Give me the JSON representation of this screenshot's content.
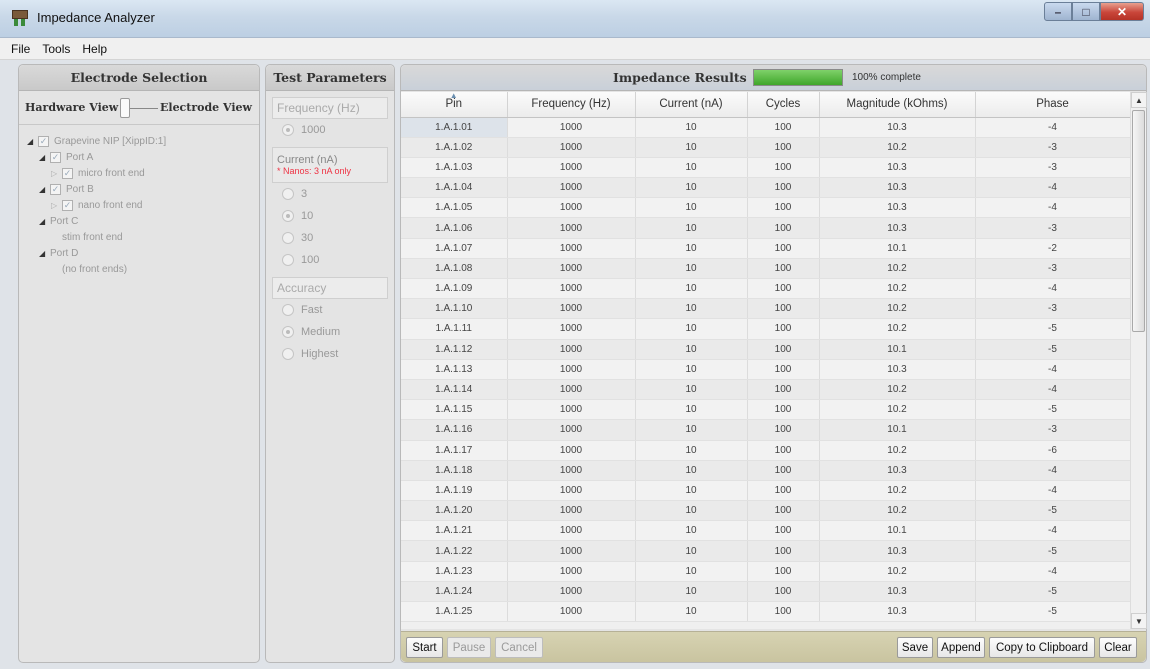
{
  "window": {
    "title": "Impedance Analyzer"
  },
  "menu": [
    "File",
    "Tools",
    "Help"
  ],
  "electrode": {
    "title": "Electrode Selection",
    "toggle_left": "Hardware View",
    "toggle_right": "Electrode View",
    "tree": [
      {
        "label": "Grapevine NIP [XippID:1]",
        "level": 0,
        "tri": "open",
        "check": true
      },
      {
        "label": "Port A",
        "level": 1,
        "tri": "open",
        "check": true
      },
      {
        "label": "micro front end",
        "level": 2,
        "tri": "closed",
        "check": true
      },
      {
        "label": "Port B",
        "level": 1,
        "tri": "open",
        "check": true
      },
      {
        "label": "nano front end",
        "level": 2,
        "tri": "closed",
        "check": true
      },
      {
        "label": "Port C",
        "level": 1,
        "tri": "open",
        "check": false
      },
      {
        "label": "stim front end",
        "level": 2,
        "tri": "none",
        "check": false
      },
      {
        "label": "Port D",
        "level": 1,
        "tri": "open",
        "check": false
      },
      {
        "label": "(no front ends)",
        "level": 2,
        "tri": "none",
        "check": false
      }
    ]
  },
  "params": {
    "title": "Test Parameters",
    "frequency_label": "Frequency (Hz)",
    "frequency_option": "1000",
    "current_label": "Current (nA)",
    "current_note": "* Nanos: 3 nA only",
    "current_options": [
      "3",
      "10",
      "30",
      "100"
    ],
    "current_selected": "10",
    "accuracy_label": "Accuracy",
    "accuracy_options": [
      "Fast",
      "Medium",
      "Highest"
    ],
    "accuracy_selected": "Medium"
  },
  "results": {
    "title": "Impedance Results",
    "progress_fraction": 1.0,
    "progress_text": "100% complete",
    "columns": [
      "Pin",
      "Frequency (Hz)",
      "Current (nA)",
      "Cycles",
      "Magnitude (kOhms)",
      "Phase"
    ],
    "rows": [
      [
        "1.A.1.01",
        "1000",
        "10",
        "100",
        "10.3",
        "-4"
      ],
      [
        "1.A.1.02",
        "1000",
        "10",
        "100",
        "10.2",
        "-3"
      ],
      [
        "1.A.1.03",
        "1000",
        "10",
        "100",
        "10.3",
        "-3"
      ],
      [
        "1.A.1.04",
        "1000",
        "10",
        "100",
        "10.3",
        "-4"
      ],
      [
        "1.A.1.05",
        "1000",
        "10",
        "100",
        "10.3",
        "-4"
      ],
      [
        "1.A.1.06",
        "1000",
        "10",
        "100",
        "10.3",
        "-3"
      ],
      [
        "1.A.1.07",
        "1000",
        "10",
        "100",
        "10.1",
        "-2"
      ],
      [
        "1.A.1.08",
        "1000",
        "10",
        "100",
        "10.2",
        "-3"
      ],
      [
        "1.A.1.09",
        "1000",
        "10",
        "100",
        "10.2",
        "-4"
      ],
      [
        "1.A.1.10",
        "1000",
        "10",
        "100",
        "10.2",
        "-3"
      ],
      [
        "1.A.1.11",
        "1000",
        "10",
        "100",
        "10.2",
        "-5"
      ],
      [
        "1.A.1.12",
        "1000",
        "10",
        "100",
        "10.1",
        "-5"
      ],
      [
        "1.A.1.13",
        "1000",
        "10",
        "100",
        "10.3",
        "-4"
      ],
      [
        "1.A.1.14",
        "1000",
        "10",
        "100",
        "10.2",
        "-4"
      ],
      [
        "1.A.1.15",
        "1000",
        "10",
        "100",
        "10.2",
        "-5"
      ],
      [
        "1.A.1.16",
        "1000",
        "10",
        "100",
        "10.1",
        "-3"
      ],
      [
        "1.A.1.17",
        "1000",
        "10",
        "100",
        "10.2",
        "-6"
      ],
      [
        "1.A.1.18",
        "1000",
        "10",
        "100",
        "10.3",
        "-4"
      ],
      [
        "1.A.1.19",
        "1000",
        "10",
        "100",
        "10.2",
        "-4"
      ],
      [
        "1.A.1.20",
        "1000",
        "10",
        "100",
        "10.2",
        "-5"
      ],
      [
        "1.A.1.21",
        "1000",
        "10",
        "100",
        "10.1",
        "-4"
      ],
      [
        "1.A.1.22",
        "1000",
        "10",
        "100",
        "10.3",
        "-5"
      ],
      [
        "1.A.1.23",
        "1000",
        "10",
        "100",
        "10.2",
        "-4"
      ],
      [
        "1.A.1.24",
        "1000",
        "10",
        "100",
        "10.3",
        "-5"
      ],
      [
        "1.A.1.25",
        "1000",
        "10",
        "100",
        "10.3",
        "-5"
      ]
    ],
    "buttons_left": [
      {
        "label": "Start",
        "enabled": true
      },
      {
        "label": "Pause",
        "enabled": false
      },
      {
        "label": "Cancel",
        "enabled": false
      }
    ],
    "buttons_right": [
      {
        "label": "Save",
        "enabled": true
      },
      {
        "label": "Append",
        "enabled": true
      },
      {
        "label": "Copy to Clipboard",
        "enabled": true
      },
      {
        "label": "Clear",
        "enabled": true
      }
    ]
  },
  "colors": {
    "progress": "#3fa62a",
    "note": "#e33344",
    "bottom_bar": "#cdc8a6"
  }
}
